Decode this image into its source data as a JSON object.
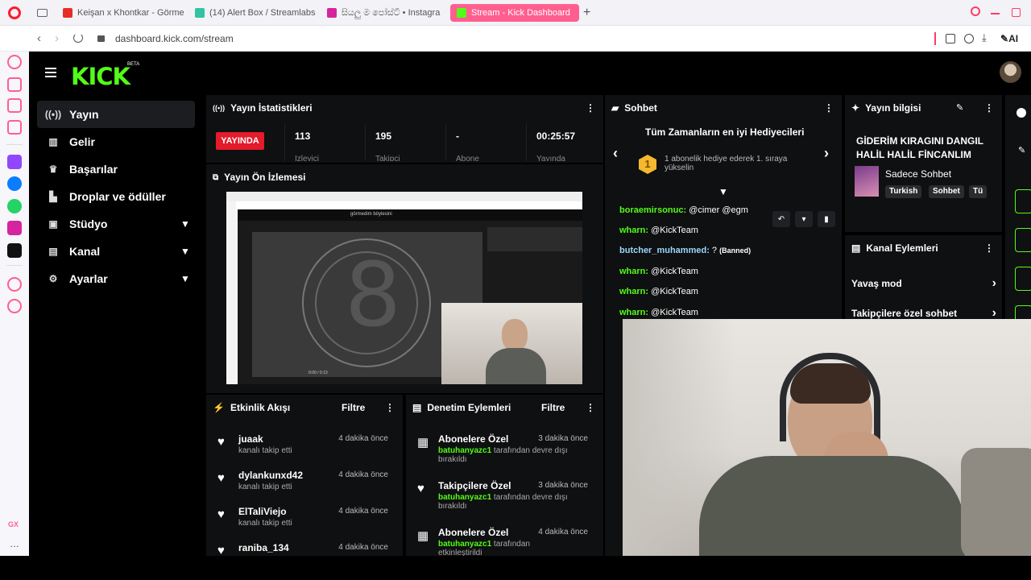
{
  "browser": {
    "tabs": [
      {
        "label": "Keişan x Khontkar - Görme",
        "color": "#e52d27"
      },
      {
        "label": "(14) Alert Box / Streamlabs",
        "color": "#31c3a2"
      },
      {
        "label": "සියලු ම පෝස්ට් • Instagra",
        "color": "#d6249f"
      },
      {
        "label": "Stream - Kick Dashboard",
        "color": "#53fc18"
      }
    ],
    "url": "dashboard.kick.com/stream",
    "ai_label": "AI"
  },
  "kick": {
    "logo": "KICK",
    "beta": "BETA",
    "nav": [
      {
        "label": "Yayın",
        "icon": "broadcast-icon"
      },
      {
        "label": "Gelir",
        "icon": "chart-icon"
      },
      {
        "label": "Başarılar",
        "icon": "trophy-icon"
      },
      {
        "label": "Droplar ve ödüller",
        "icon": "drops-icon"
      },
      {
        "label": "Stüdyo",
        "icon": "studio-icon"
      },
      {
        "label": "Kanal",
        "icon": "channel-icon"
      },
      {
        "label": "Ayarlar",
        "icon": "settings-icon"
      }
    ]
  },
  "stats": {
    "title": "Yayın İstatistikleri",
    "live": "YAYINDA",
    "viewers": "113",
    "viewers_label": "İzleyici",
    "followers": "195",
    "followers_label": "Takipçi",
    "subs": "-",
    "subs_label": "Abone",
    "time": "00:25:57",
    "time_label": "Yayında"
  },
  "preview": {
    "title": "Yayın Ön İzlemesi",
    "inner_search": "görmedim böylesini",
    "inner_time": "0:00 / 0:13"
  },
  "activity": {
    "title": "Etkinlik Akışı",
    "filter": "Filtre",
    "items": [
      {
        "name": "juaak",
        "sub": "kanalı takip etti",
        "time": "4 dakika önce"
      },
      {
        "name": "dylankunxd42",
        "sub": "kanalı takip etti",
        "time": "4 dakika önce"
      },
      {
        "name": "ElTaliViejo",
        "sub": "kanalı takip etti",
        "time": "4 dakika önce"
      },
      {
        "name": "raniba_134",
        "sub": "",
        "time": "4 dakika önce"
      }
    ]
  },
  "moderation": {
    "title": "Denetim Eylemleri",
    "filter": "Filtre",
    "items": [
      {
        "name": "Abonelere Özel",
        "user": "batuhanyazc1",
        "rest": "tarafından devre dışı",
        "rest2": "bırakıldı",
        "time": "3 dakika önce"
      },
      {
        "name": "Takipçilere Özel",
        "user": "batuhanyazc1",
        "rest": "tarafından devre dışı",
        "rest2": "bırakıldı",
        "time": "3 dakika önce"
      },
      {
        "name": "Abonelere Özel",
        "user": "batuhanyazc1",
        "rest": "tarafından etkinleştirildi",
        "rest2": "",
        "time": "4 dakika önce"
      }
    ]
  },
  "chat": {
    "title": "Sohbet",
    "gifters_title": "Tüm Zamanların en iyi Hediyecileri",
    "gifter_rank": "1",
    "gifter_text_1": "1 abonelik hediye ederek 1. sıraya",
    "gifter_text_2": "yükselin",
    "messages": [
      {
        "user": "boraemirsonuc:",
        "text": "@cimer @egm"
      },
      {
        "user": "wharn:",
        "text": "@KickTeam"
      },
      {
        "user": "butcher_muhammed:",
        "text": "?",
        "tag": "(Banned)"
      },
      {
        "user": "wharn:",
        "text": "@KickTeam"
      },
      {
        "user": "wharn:",
        "text": "@KickTeam"
      },
      {
        "user": "wharn:",
        "text": "@KickTeam"
      }
    ]
  },
  "info": {
    "title": "Yayın bilgisi",
    "stream_title": "GİDERİM KIRAGINI DANGIL HALİL HALİL FİNCANLIM",
    "category": "Sadece Sohbet",
    "tags": [
      "Turkish",
      "Sohbet",
      "Tü"
    ]
  },
  "channel_actions": {
    "title": "Kanal Eylemleri",
    "items": [
      "Yavaş mod",
      "Takipçilere özel sohbet"
    ]
  },
  "colors": {
    "accent": "#53fc18",
    "live": "#e31b2b",
    "browser_accent": "#ff5f8f"
  }
}
